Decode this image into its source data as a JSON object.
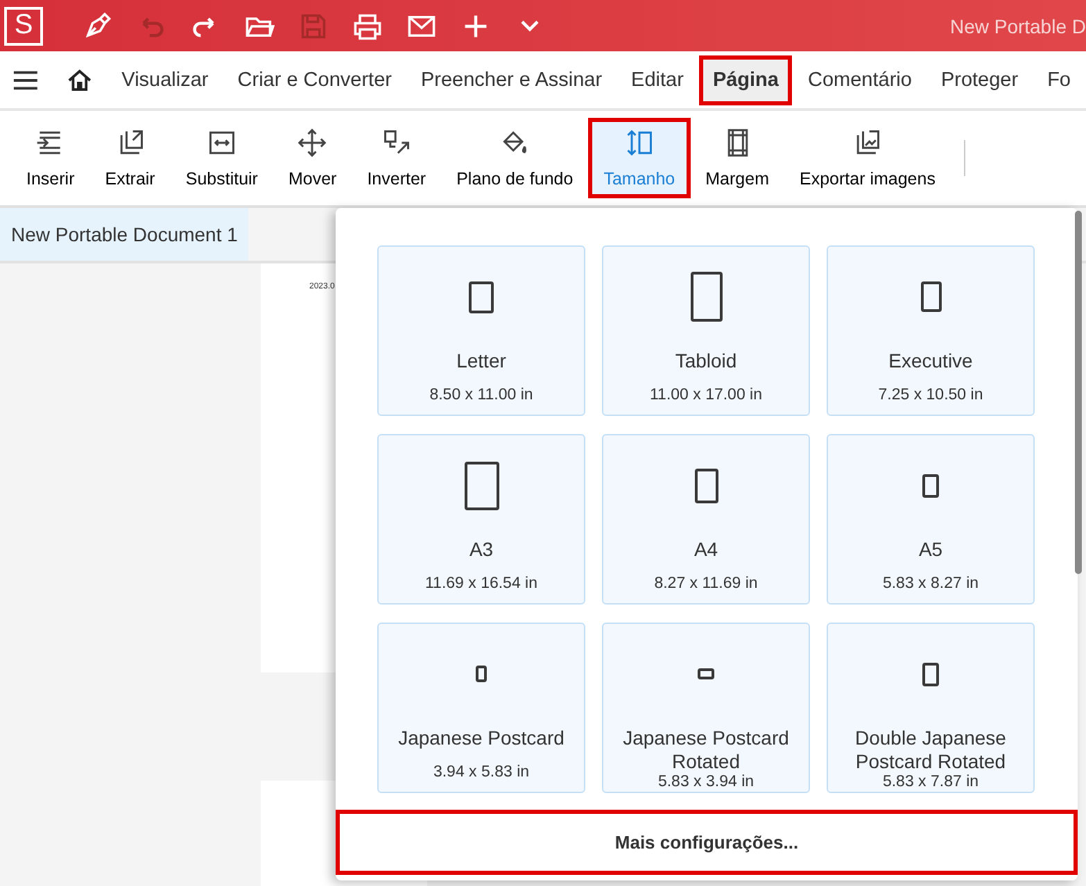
{
  "title_bar": {
    "logo": "S",
    "document_title": "New Portable D"
  },
  "menu": [
    {
      "label": "Visualizar",
      "selected": false
    },
    {
      "label": "Criar e Converter",
      "selected": false
    },
    {
      "label": "Preencher e Assinar",
      "selected": false
    },
    {
      "label": "Editar",
      "selected": false
    },
    {
      "label": "Página",
      "selected": true
    },
    {
      "label": "Comentário",
      "selected": false
    },
    {
      "label": "Proteger",
      "selected": false
    },
    {
      "label": "Fo",
      "selected": false
    }
  ],
  "toolbar": [
    {
      "label": "Inserir",
      "selected": false
    },
    {
      "label": "Extrair",
      "selected": false
    },
    {
      "label": "Substituir",
      "selected": false
    },
    {
      "label": "Mover",
      "selected": false
    },
    {
      "label": "Inverter",
      "selected": false
    },
    {
      "label": "Plano de fundo",
      "selected": false
    },
    {
      "label": "Tamanho",
      "selected": true
    },
    {
      "label": "Margem",
      "selected": false
    },
    {
      "label": "Exportar imagens",
      "selected": false
    }
  ],
  "document_tab": {
    "label": "New Portable Document 1"
  },
  "page_text": "2023.0",
  "size_menu": {
    "sizes": [
      {
        "name": "Letter",
        "dimensions": "8.50 x 11.00 in"
      },
      {
        "name": "Tabloid",
        "dimensions": "11.00 x 17.00 in"
      },
      {
        "name": "Executive",
        "dimensions": "7.25 x 10.50 in"
      },
      {
        "name": "A3",
        "dimensions": "11.69 x 16.54 in"
      },
      {
        "name": "A4",
        "dimensions": "8.27 x 11.69 in"
      },
      {
        "name": "A5",
        "dimensions": "5.83 x 8.27 in"
      },
      {
        "name": "Japanese Postcard",
        "dimensions": "3.94 x 5.83 in"
      },
      {
        "name": "Japanese Postcard Rotated",
        "dimensions": "5.83 x 3.94 in"
      },
      {
        "name": "Double Japanese Postcard Rotated",
        "dimensions": "5.83 x 7.87 in"
      }
    ],
    "more_button": "Mais configurações..."
  }
}
